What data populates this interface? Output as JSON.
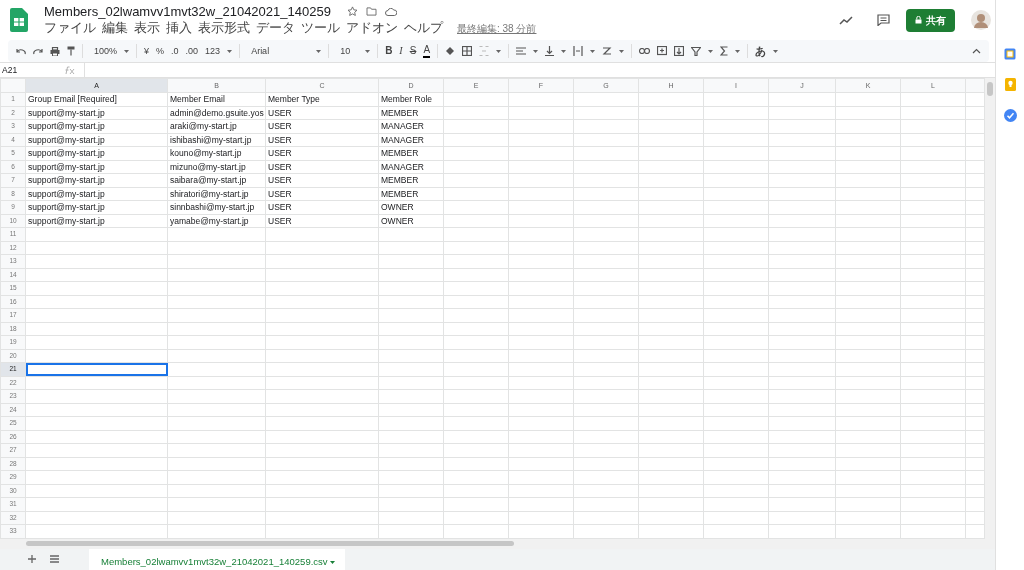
{
  "document": {
    "title": "Members_02lwamvv1mvt32w_21042021_140259",
    "last_edit": "最終編集: 38 分前",
    "share_button": "共有"
  },
  "menu": [
    "ファイル",
    "編集",
    "表示",
    "挿入",
    "表示形式",
    "データ",
    "ツール",
    "アドオン",
    "ヘルプ"
  ],
  "toolbar": {
    "zoom": "100%",
    "currency": "¥",
    "percent": "%",
    "decimal_decrease": ".0",
    "decimal_increase": ".00",
    "number_format": "123",
    "font": "Arial",
    "font_size": "10",
    "bold": "B",
    "italic": "I",
    "strikethrough": "S",
    "text_color": "A",
    "input_tools": "あ"
  },
  "name_box": "A21",
  "columns": [
    {
      "label": "A",
      "selected": true
    },
    {
      "label": "B",
      "selected": false
    },
    {
      "label": "C",
      "selected": false
    },
    {
      "label": "D",
      "selected": false
    },
    {
      "label": "E",
      "selected": false
    },
    {
      "label": "F",
      "selected": false
    },
    {
      "label": "G",
      "selected": false
    },
    {
      "label": "H",
      "selected": false
    },
    {
      "label": "I",
      "selected": false
    },
    {
      "label": "J",
      "selected": false
    },
    {
      "label": "K",
      "selected": false
    },
    {
      "label": "L",
      "selected": false
    }
  ],
  "rows": [
    {
      "number": "1",
      "selected": false,
      "cells": [
        "Group Email [Required]",
        "Member Email",
        "Member Type",
        "Member Role"
      ]
    },
    {
      "number": "2",
      "selected": false,
      "cells": [
        "support@my-start.jp",
        "admin@demo.gsuite.yos",
        "USER",
        "MEMBER"
      ]
    },
    {
      "number": "3",
      "selected": false,
      "cells": [
        "support@my-start.jp",
        "araki@my-start.jp",
        "USER",
        "MANAGER"
      ]
    },
    {
      "number": "4",
      "selected": false,
      "cells": [
        "support@my-start.jp",
        "ishibashi@my-start.jp",
        "USER",
        "MANAGER"
      ]
    },
    {
      "number": "5",
      "selected": false,
      "cells": [
        "support@my-start.jp",
        "kouno@my-start.jp",
        "USER",
        "MEMBER"
      ]
    },
    {
      "number": "6",
      "selected": false,
      "cells": [
        "support@my-start.jp",
        "mizuno@my-start.jp",
        "USER",
        "MANAGER"
      ]
    },
    {
      "number": "7",
      "selected": false,
      "cells": [
        "support@my-start.jp",
        "saibara@my-start.jp",
        "USER",
        "MEMBER"
      ]
    },
    {
      "number": "8",
      "selected": false,
      "cells": [
        "support@my-start.jp",
        "shiratori@my-start.jp",
        "USER",
        "MEMBER"
      ]
    },
    {
      "number": "9",
      "selected": false,
      "cells": [
        "support@my-start.jp",
        "sinnbashi@my-start.jp",
        "USER",
        "OWNER"
      ]
    },
    {
      "number": "10",
      "selected": false,
      "cells": [
        "support@my-start.jp",
        "yamabe@my-start.jp",
        "USER",
        "OWNER"
      ]
    },
    {
      "number": "11",
      "selected": false
    },
    {
      "number": "12",
      "selected": false
    },
    {
      "number": "13",
      "selected": false
    },
    {
      "number": "14",
      "selected": false
    },
    {
      "number": "15",
      "selected": false
    },
    {
      "number": "16",
      "selected": false
    },
    {
      "number": "17",
      "selected": false
    },
    {
      "number": "18",
      "selected": false
    },
    {
      "number": "19",
      "selected": false
    },
    {
      "number": "20",
      "selected": false
    },
    {
      "number": "21",
      "selected": true
    },
    {
      "number": "22",
      "selected": false
    },
    {
      "number": "23",
      "selected": false
    },
    {
      "number": "24",
      "selected": false
    },
    {
      "number": "25",
      "selected": false
    },
    {
      "number": "26",
      "selected": false
    },
    {
      "number": "27",
      "selected": false
    },
    {
      "number": "28",
      "selected": false
    },
    {
      "number": "29",
      "selected": false
    },
    {
      "number": "30",
      "selected": false
    },
    {
      "number": "31",
      "selected": false
    },
    {
      "number": "32",
      "selected": false
    },
    {
      "number": "33",
      "selected": false
    }
  ],
  "sheet_tabs": [
    {
      "label": "Members_02lwamvv1mvt32w_21042021_140259.csv",
      "selected": true
    }
  ]
}
